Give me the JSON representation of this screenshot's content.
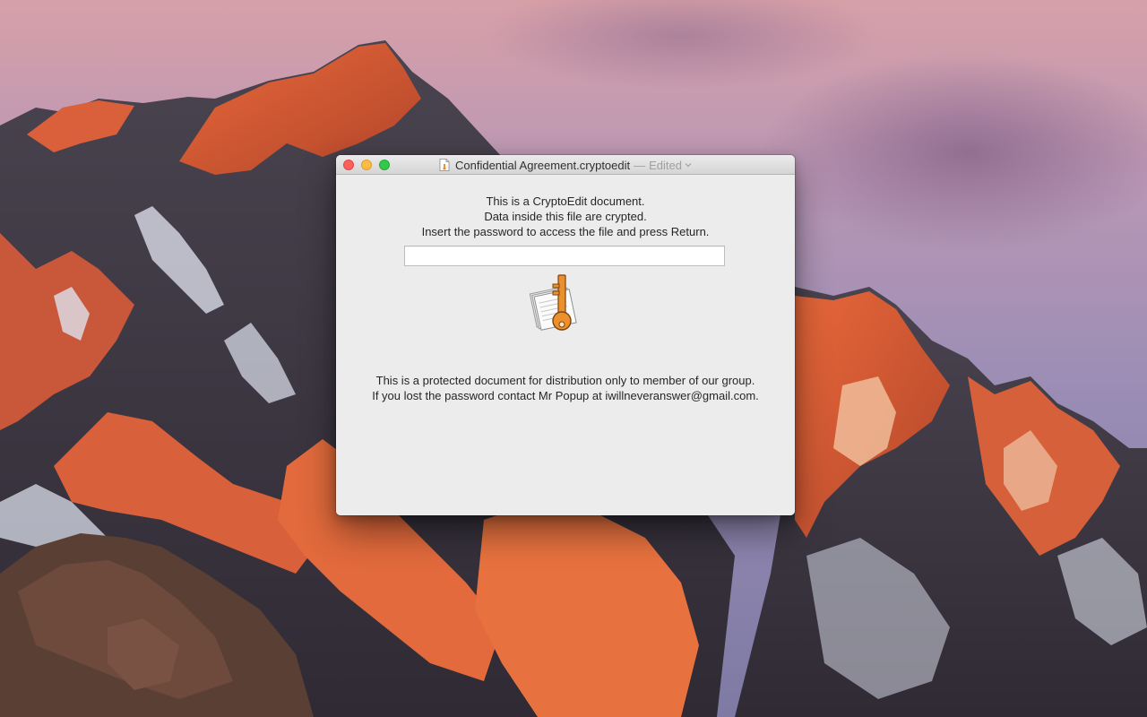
{
  "window": {
    "title": "Confidential Agreement.cryptoedit",
    "title_separator": "—",
    "status": "Edited"
  },
  "prompt": {
    "lines": [
      "This is a CryptoEdit document.",
      "Data inside this file are crypted.",
      "Insert the password to access the file and press Return."
    ]
  },
  "password_field": {
    "value": "",
    "placeholder": ""
  },
  "notice": {
    "lines": [
      "This is a  protected document for distribution only to member of our group.",
      "If you lost the password contact Mr Popup at iwillneveranswer@gmail.com."
    ]
  },
  "icons": {
    "app_icon": "document-key-icon",
    "title_icon": "document-icon",
    "title_menu": "chevron-down-icon"
  },
  "colors": {
    "key_orange": "#ec8f2d",
    "close": "#fc605c",
    "minimize": "#fdbc40",
    "zoom": "#34c84a"
  }
}
